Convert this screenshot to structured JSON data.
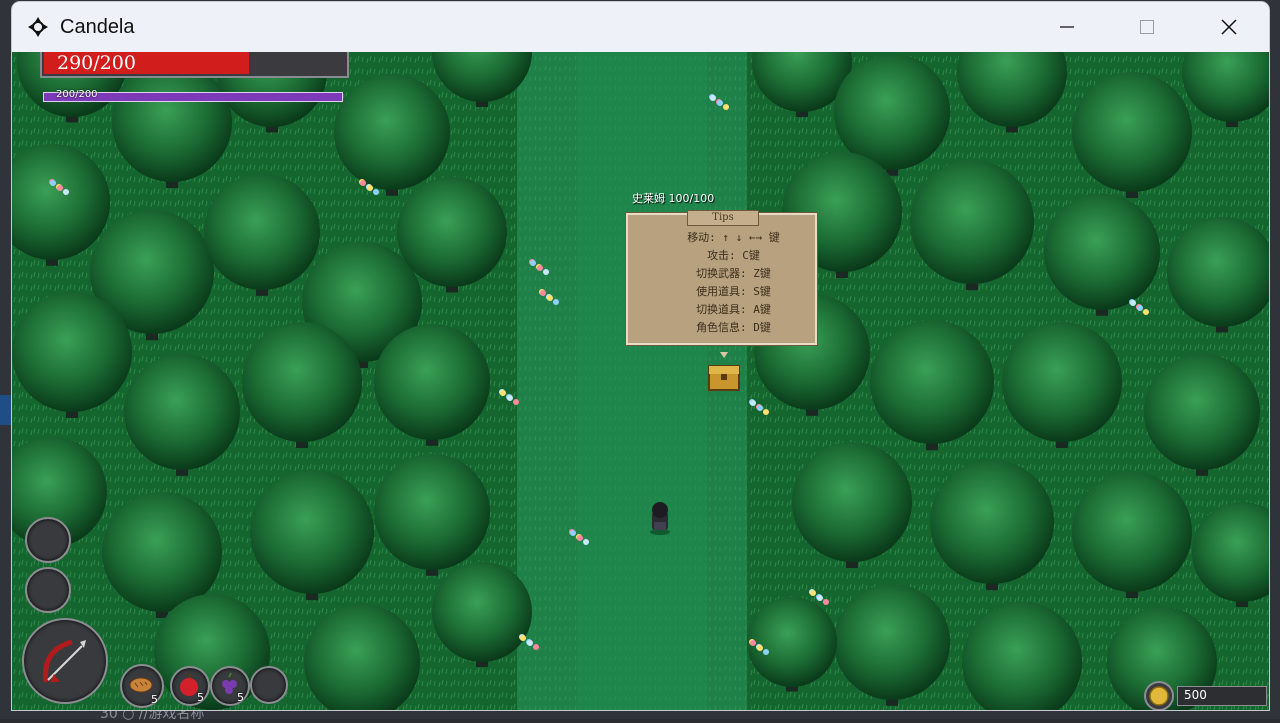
{
  "window": {
    "title": "Candela"
  },
  "desktop": {
    "bottom_text": "30   ○     //游戏名称"
  },
  "hud": {
    "hp_text": "290/200",
    "hp_fraction": 0.68,
    "mp_text": "200/200",
    "mp_fraction": 1.0,
    "items": [
      {
        "name": "bread",
        "count": "5"
      },
      {
        "name": "apple",
        "count": "5"
      },
      {
        "name": "grape",
        "count": "5"
      },
      {
        "name": "empty",
        "count": ""
      }
    ],
    "gold": "500"
  },
  "npc": {
    "name_hp": "史莱姆 100/100"
  },
  "tips": {
    "title": "Tips",
    "lines": [
      "移动: ↑ ↓ ←→ 键",
      "攻击: C键",
      "切换武器: Z键",
      "使用道具: S键",
      "切换道具: A键",
      "角色信息: D键"
    ]
  },
  "colors": {
    "hp": "#d21d1d",
    "mp": "#7c3ab8",
    "grass": "#14602e",
    "path": "#1e7f48",
    "tips_bg": "#b7a17e"
  }
}
